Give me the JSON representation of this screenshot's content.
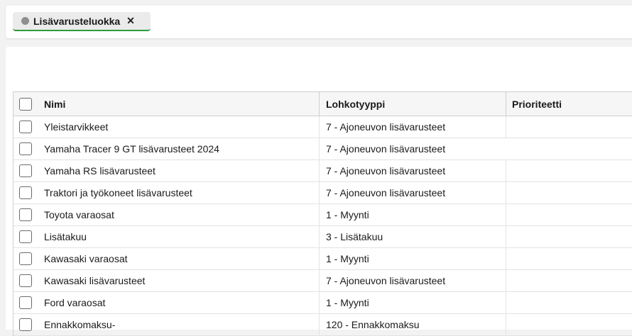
{
  "tabs": [
    {
      "label": "Lisävarusteluokka",
      "close_glyph": "✕",
      "accent": "#2e9b3c"
    }
  ],
  "table": {
    "columns": {
      "name": "Nimi",
      "type": "Lohkotyyppi",
      "priority": "Prioriteetti"
    },
    "rows": [
      {
        "name": "Yleistarvikkeet",
        "type": "7 - Ajoneuvon lisävarusteet",
        "priority": ""
      },
      {
        "name": "Yamaha Tracer 9 GT lisävarusteet 2024",
        "type": "7 - Ajoneuvon lisävarusteet",
        "priority": ""
      },
      {
        "name": "Yamaha RS lisävarusteet",
        "type": "7 - Ajoneuvon lisävarusteet",
        "priority": ""
      },
      {
        "name": "Traktori ja työkoneet lisävarusteet",
        "type": "7 - Ajoneuvon lisävarusteet",
        "priority": ""
      },
      {
        "name": "Toyota varaosat",
        "type": "1 - Myynti",
        "priority": ""
      },
      {
        "name": "Lisätakuu",
        "type": "3 - Lisätakuu",
        "priority": ""
      },
      {
        "name": "Kawasaki varaosat",
        "type": "1 - Myynti",
        "priority": ""
      },
      {
        "name": "Kawasaki lisävarusteet",
        "type": "7 - Ajoneuvon lisävarusteet",
        "priority": ""
      },
      {
        "name": "Ford varaosat",
        "type": "1 - Myynti",
        "priority": ""
      },
      {
        "name": "Ennakkomaksu-",
        "type": "120 - Ennakkomaksu",
        "priority": ""
      }
    ]
  }
}
